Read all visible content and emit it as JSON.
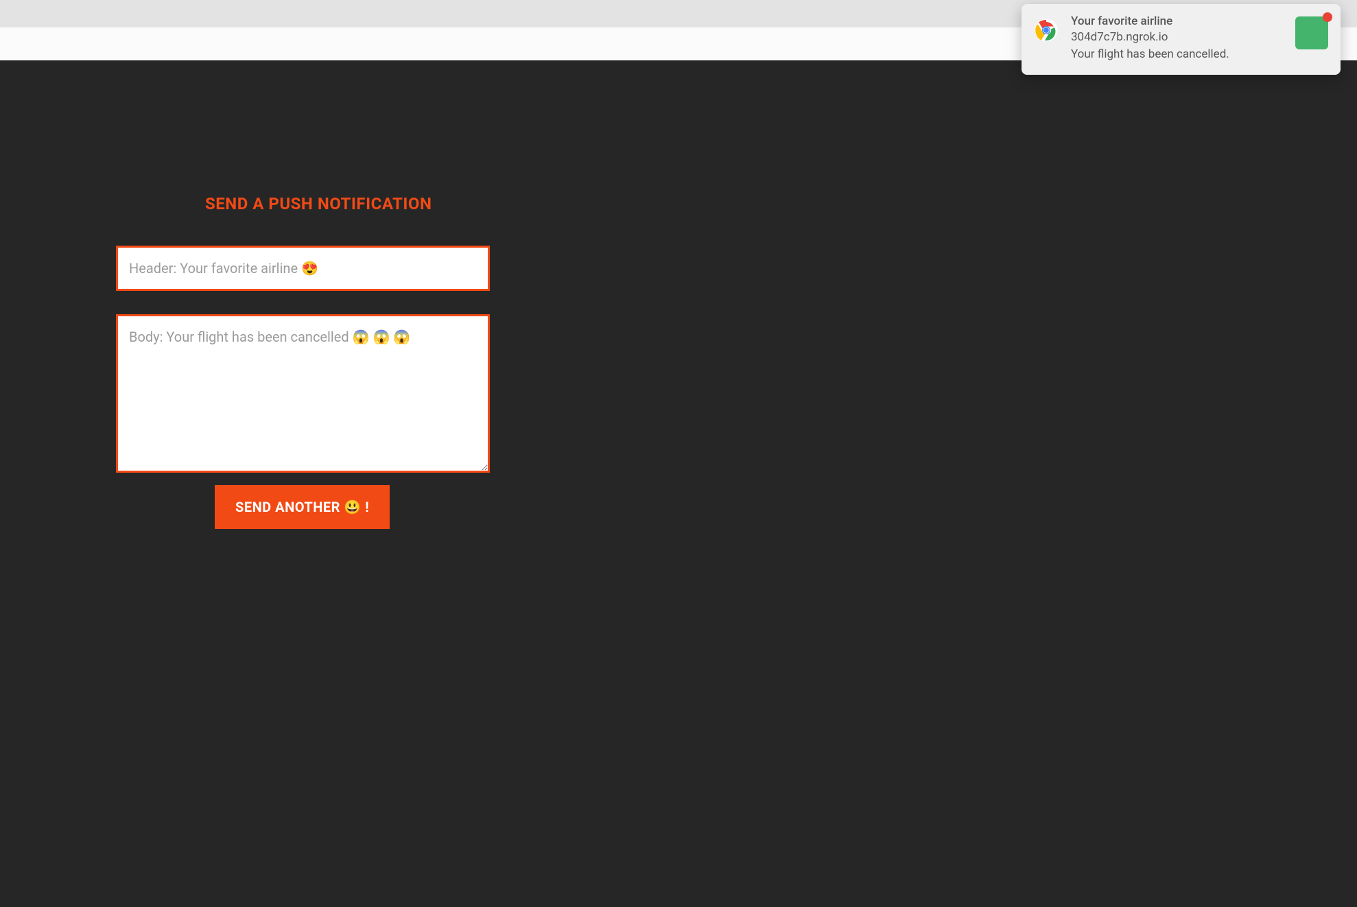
{
  "notification": {
    "title": "Your favorite airline",
    "origin": "304d7c7b.ngrok.io",
    "body": "Your flight has been cancelled."
  },
  "form": {
    "heading": "SEND A PUSH NOTIFICATION",
    "header_placeholder": "Header: Your favorite airline 😍",
    "body_placeholder": "Body: Your flight has been cancelled 😱 😱 😱",
    "button_label": "SEND ANOTHER 😃 !"
  }
}
